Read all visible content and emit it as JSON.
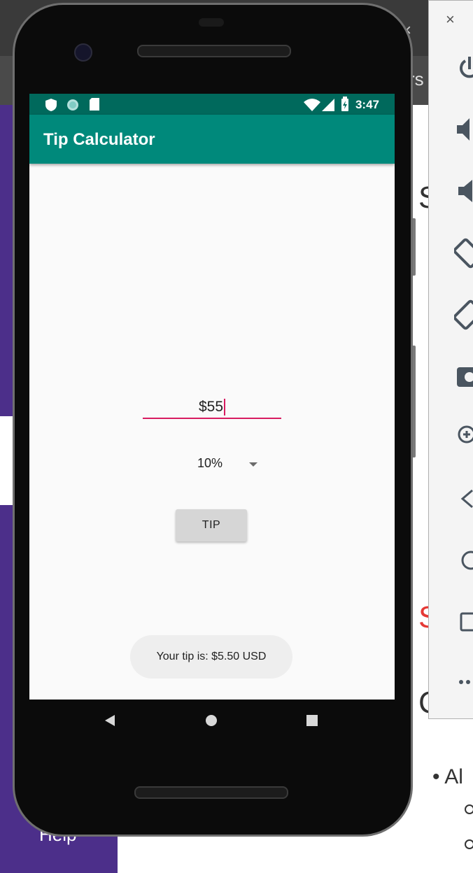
{
  "background_page": {
    "tab_fragment": "rs",
    "tab_close_glyph": "×",
    "letter_top": "S",
    "letter_mid": "S",
    "letter_low": "C",
    "bullet_text": "Al",
    "sidebar_help": "Help"
  },
  "status_bar": {
    "time": "3:47",
    "left_icons": [
      "shield-icon",
      "circle-icon",
      "sd-card-icon"
    ],
    "right_icons": [
      "wifi-icon",
      "cellular-icon",
      "battery-charging-icon"
    ]
  },
  "app": {
    "title": "Tip Calculator",
    "amount_value": "$55",
    "tip_percent": "10%",
    "tip_button_label": "TIP",
    "toast_message": "Your tip is: $5.50 USD"
  },
  "nav_bar": {
    "buttons": [
      "back-icon",
      "home-icon",
      "recents-icon"
    ]
  },
  "emulator_panel": {
    "close_label": "×",
    "controls": [
      "power-icon",
      "volume-up-icon",
      "volume-down-icon",
      "rotate-left-icon",
      "rotate-right-icon",
      "screenshot-icon",
      "zoom-icon",
      "back-icon",
      "home-icon",
      "overview-icon",
      "more-icon"
    ]
  },
  "colors": {
    "app_bar": "#00897b",
    "status_bar": "#00695c",
    "accent": "#d81b60",
    "sidebar_purple": "#4c2f8a"
  }
}
